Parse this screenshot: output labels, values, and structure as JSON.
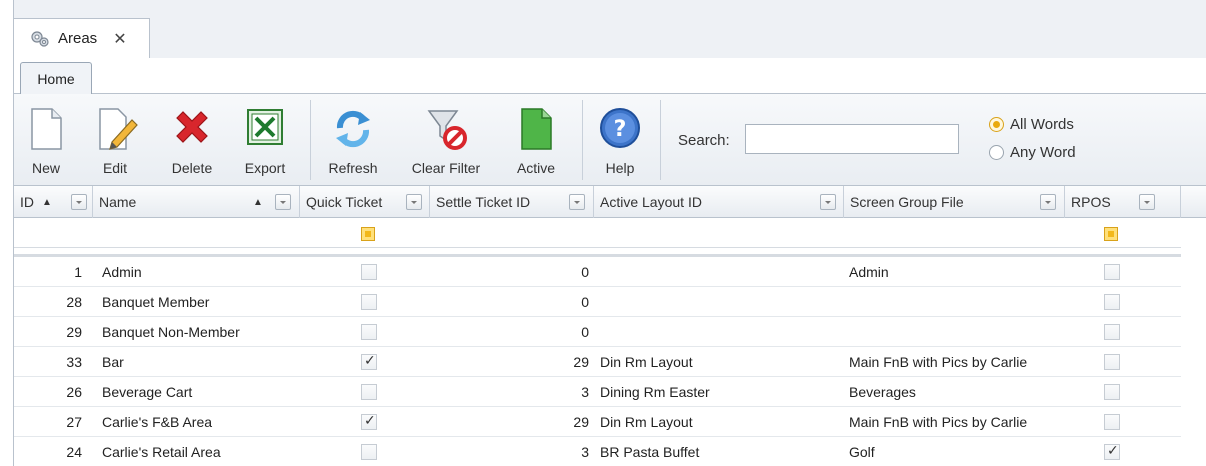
{
  "document_tab": {
    "label": "Areas",
    "close": "✕"
  },
  "ribbon_tab": {
    "label": "Home"
  },
  "toolbar": {
    "buttons": [
      {
        "label": "New",
        "icon": "new-document-icon"
      },
      {
        "label": "Edit",
        "icon": "edit-pencil-icon"
      },
      {
        "label": "Delete",
        "icon": "delete-x-icon"
      },
      {
        "label": "Export",
        "icon": "excel-export-icon"
      },
      {
        "label": "Refresh",
        "icon": "refresh-arrows-icon"
      },
      {
        "label": "Clear Filter",
        "icon": "clear-filter-funnel-icon"
      },
      {
        "label": "Active",
        "icon": "active-document-icon"
      },
      {
        "label": "Help",
        "icon": "help-question-icon"
      }
    ]
  },
  "search": {
    "label": "Search:",
    "value": "",
    "placeholder": ""
  },
  "match_mode": {
    "options": [
      "All Words",
      "Any Word"
    ],
    "selected": "All Words"
  },
  "grid": {
    "columns": [
      {
        "label": "ID",
        "sort": "asc"
      },
      {
        "label": "Name",
        "sort": "asc"
      },
      {
        "label": "Quick Ticket"
      },
      {
        "label": "Settle Ticket ID"
      },
      {
        "label": "Active Layout ID"
      },
      {
        "label": "Screen Group File"
      },
      {
        "label": "RPOS"
      }
    ],
    "rows": [
      {
        "id": "1",
        "name": "Admin",
        "quick_ticket": false,
        "settle_ticket_id": "0",
        "active_layout": "",
        "screen_group_file": "Admin",
        "rpos": false
      },
      {
        "id": "28",
        "name": "Banquet Member",
        "quick_ticket": false,
        "settle_ticket_id": "0",
        "active_layout": "",
        "screen_group_file": "",
        "rpos": false
      },
      {
        "id": "29",
        "name": "Banquet Non-Member",
        "quick_ticket": false,
        "settle_ticket_id": "0",
        "active_layout": "",
        "screen_group_file": "",
        "rpos": false
      },
      {
        "id": "33",
        "name": "Bar",
        "quick_ticket": true,
        "settle_ticket_id": "29",
        "active_layout": "Din Rm Layout",
        "screen_group_file": "Main FnB with Pics by Carlie",
        "rpos": false
      },
      {
        "id": "26",
        "name": "Beverage Cart",
        "quick_ticket": false,
        "settle_ticket_id": "3",
        "active_layout": "Dining Rm Easter",
        "screen_group_file": "Beverages",
        "rpos": false
      },
      {
        "id": "27",
        "name": "Carlie's F&B Area",
        "quick_ticket": true,
        "settle_ticket_id": "29",
        "active_layout": "Din Rm Layout",
        "screen_group_file": "Main FnB with Pics by Carlie",
        "rpos": false
      },
      {
        "id": "24",
        "name": "Carlie's Retail Area",
        "quick_ticket": false,
        "settle_ticket_id": "3",
        "active_layout": "BR Pasta Buffet",
        "screen_group_file": "Golf",
        "rpos": true
      }
    ]
  },
  "colors": {
    "accent": "#e9a90d",
    "border": "#b9c2cd",
    "header_bg": "#e8ecf1"
  }
}
